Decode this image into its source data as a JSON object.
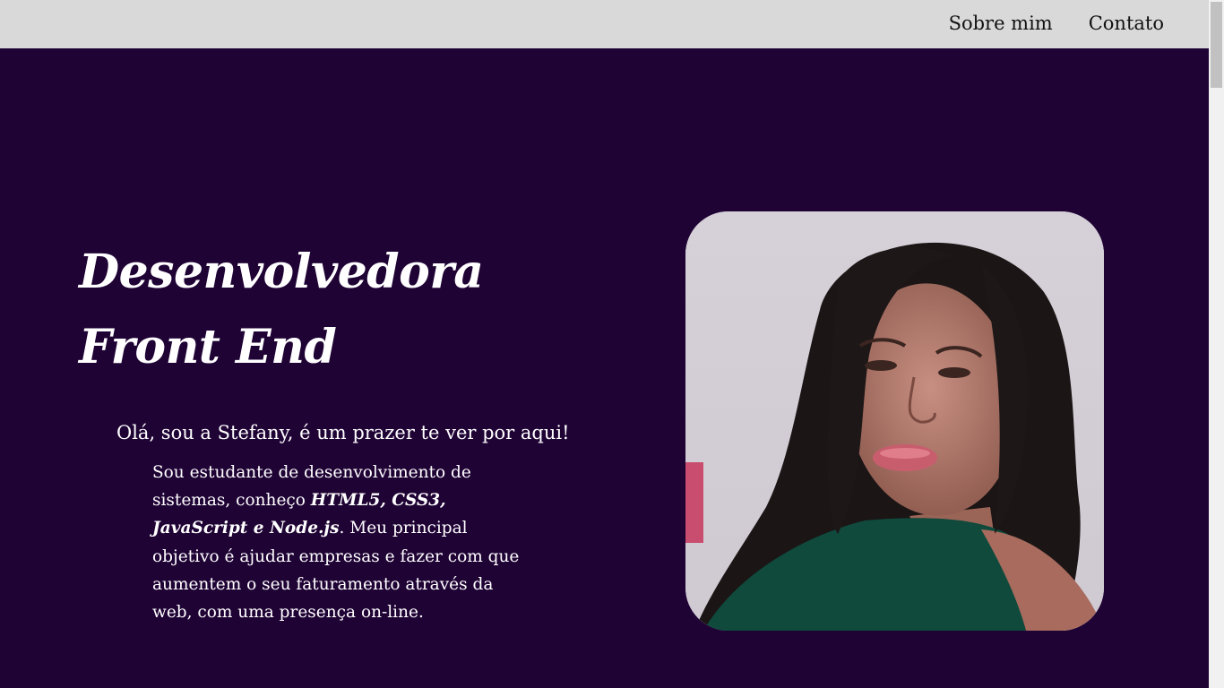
{
  "nav": {
    "items": [
      "Sobre mim",
      "Contato"
    ]
  },
  "hero": {
    "title_line1": "Desenvolvedora",
    "title_line2": "Front End",
    "greeting": "Olá, sou a Stefany, é um prazer te ver por aqui!",
    "bio_part1": "Sou estudante de desenvolvimento de sistemas, conheço ",
    "bio_skills": "HTML5, CSS3, JavaScript e Node.js",
    "bio_part2": ". Meu principal objetivo é ajudar empresas e fazer com que aumentem o seu faturamento através da web, com uma presença on-line."
  },
  "colors": {
    "background": "#1f0335",
    "topbar": "#d9d9d9",
    "text": "#ffffff"
  }
}
